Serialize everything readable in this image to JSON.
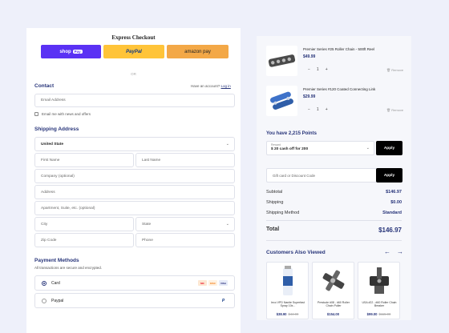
{
  "express": {
    "title": "Express Checkout",
    "shop_label": "shop",
    "shop_tag": "Pay",
    "paypal_label": "PayPal",
    "amazon_label": "amazon pay",
    "or": "OR"
  },
  "contact": {
    "title": "Contact",
    "have_account": "Have an account?",
    "login": "Log in",
    "email_placeholder": "Email Address",
    "newsletter": "Email me with news and offers"
  },
  "shipping": {
    "title": "Shipping Address",
    "country": "United State",
    "first_name": "First Name",
    "last_name": "Last Name",
    "company": "Company (optional)",
    "address": "Address",
    "apartment": "Apartment, Suite, etc. (optional)",
    "city": "City",
    "state": "State",
    "zip": "Zip Code",
    "phone": "Phone"
  },
  "payment": {
    "title": "Payment Methods",
    "note": "All transactions are secure and encrypted.",
    "card_label": "Card",
    "paypal_label": "Paypal",
    "card_brands": [
      "MC",
      "DISC",
      "VISA"
    ],
    "paypal_icon": "P"
  },
  "cart": {
    "items": [
      {
        "name": "Premier Series #25 Roller Chain - 500ft Reel",
        "price": "$49.99",
        "qty": "1",
        "remove": "Remove"
      },
      {
        "name": "Premier Series #120 Coated Connecting Link",
        "price": "$29.99",
        "qty": "1",
        "remove": "Remove"
      }
    ],
    "minus": "−",
    "plus": "+"
  },
  "rewards": {
    "points_text": "You have 2,215 Points",
    "label": "Reward",
    "value": "$ 20 cash off for 200",
    "apply": "Apply"
  },
  "discount": {
    "placeholder": "Gift card or Discount Code",
    "apply": "Apply"
  },
  "summary": {
    "subtotal_label": "Subtotal",
    "subtotal": "$146.97",
    "shipping_label": "Shipping",
    "shipping": "$0.00",
    "method_label": "Shipping Method",
    "method": "Standard",
    "total_label": "Total",
    "total": "$146.97"
  },
  "also_viewed": {
    "title": "Customers Also Viewed",
    "prev": "←",
    "next": "→",
    "items": [
      {
        "name": "Ieco VPD Nanite Superfast Spray 10x...",
        "price": "$38.90",
        "old": "$44.00"
      },
      {
        "name": "Prestude #08 - #60 Roller Chain Puller",
        "price": "$154.00",
        "old": ""
      },
      {
        "name": "USA #22 - #60 Roller Chain Breaker",
        "price": "$99.00",
        "old": "$115.00"
      }
    ]
  }
}
